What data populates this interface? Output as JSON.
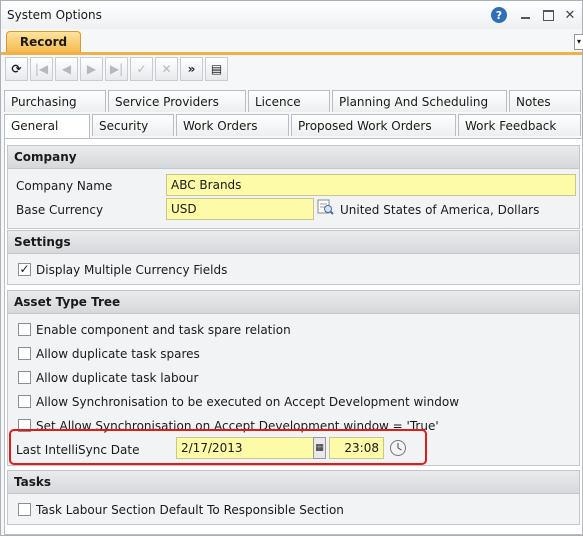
{
  "window": {
    "title": "System Options"
  },
  "record_tab": {
    "label": "Record"
  },
  "tabs_row1": [
    "Purchasing",
    "Service Providers",
    "Licence",
    "Planning And Scheduling",
    "Notes"
  ],
  "tabs_row2": [
    "General",
    "Security",
    "Work Orders",
    "Proposed Work Orders",
    "Work Feedback"
  ],
  "company": {
    "header": "Company",
    "name_label": "Company Name",
    "name_value": "ABC Brands",
    "currency_label": "Base Currency",
    "currency_value": "USD",
    "currency_desc": "United States of America, Dollars"
  },
  "settings": {
    "header": "Settings",
    "display_multi_currency": {
      "label": "Display Multiple Currency Fields",
      "checked": true
    }
  },
  "asset_tree": {
    "header": "Asset Type Tree",
    "options": [
      "Enable component and task spare relation",
      "Allow duplicate task spares",
      "Allow duplicate task labour",
      "Allow Synchronisation to be executed on Accept Development window",
      "Set Allow Synchronisation on Accept Development window = 'True'"
    ],
    "sync_label": "Last IntelliSync Date",
    "sync_date": "2/17/2013",
    "sync_time": "23:08"
  },
  "tasks": {
    "header": "Tasks",
    "option": "Task Labour Section Default To Responsible Section"
  },
  "colors": {
    "accent": "#f5b84a",
    "field_bg": "#fdfaa8",
    "highlight": "#e01b1b"
  }
}
